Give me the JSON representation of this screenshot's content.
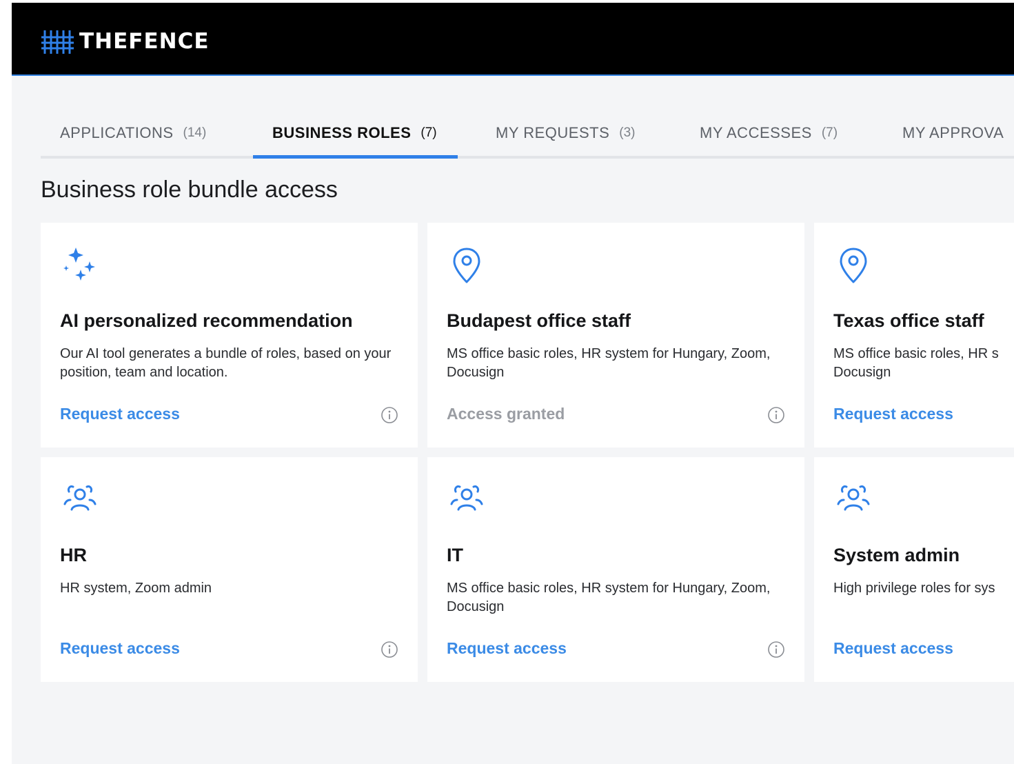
{
  "brand": {
    "name": "THEFENCE",
    "logo_icon": "fence-grid-icon"
  },
  "colors": {
    "accent": "#2f80e8",
    "link": "#3b8be6",
    "muted": "#9a9da3",
    "topbar": "#000000",
    "background": "#f4f5f7"
  },
  "tabs": [
    {
      "label": "APPLICATIONS",
      "count": "(14)",
      "active": false
    },
    {
      "label": "BUSINESS ROLES",
      "count": "(7)",
      "active": true
    },
    {
      "label": "MY REQUESTS",
      "count": "(3)",
      "active": false
    },
    {
      "label": "MY ACCESSES",
      "count": "(7)",
      "active": false
    },
    {
      "label": "MY APPROVA",
      "count": "",
      "active": false
    }
  ],
  "section": {
    "title": "Business role bundle access"
  },
  "cards": [
    {
      "icon": "sparkles-icon",
      "title": "AI personalized recommendation",
      "description": "Our AI tool generates a bundle of roles, based on your position, team and location.",
      "action": "Request access",
      "action_state": "request",
      "info_icon": "info-icon"
    },
    {
      "icon": "map-pin-icon",
      "title": "Budapest office staff",
      "description": "MS office basic roles, HR system for Hungary, Zoom, Docusign",
      "action": "Access granted",
      "action_state": "granted",
      "info_icon": "info-icon"
    },
    {
      "icon": "map-pin-icon",
      "title": "Texas office staff",
      "description": "MS office basic roles, HR s Docusign",
      "action": "Request access",
      "action_state": "request",
      "info_icon": ""
    },
    {
      "icon": "users-group-icon",
      "title": "HR",
      "description": "HR system, Zoom admin",
      "action": "Request access",
      "action_state": "request",
      "info_icon": "info-icon"
    },
    {
      "icon": "users-group-icon",
      "title": "IT",
      "description": "MS office basic roles, HR system for Hungary, Zoom, Docusign",
      "action": "Request access",
      "action_state": "request",
      "info_icon": "info-icon"
    },
    {
      "icon": "users-group-icon",
      "title": "System admin",
      "description": "High privilege roles for sys",
      "action": "Request access",
      "action_state": "request",
      "info_icon": ""
    }
  ]
}
